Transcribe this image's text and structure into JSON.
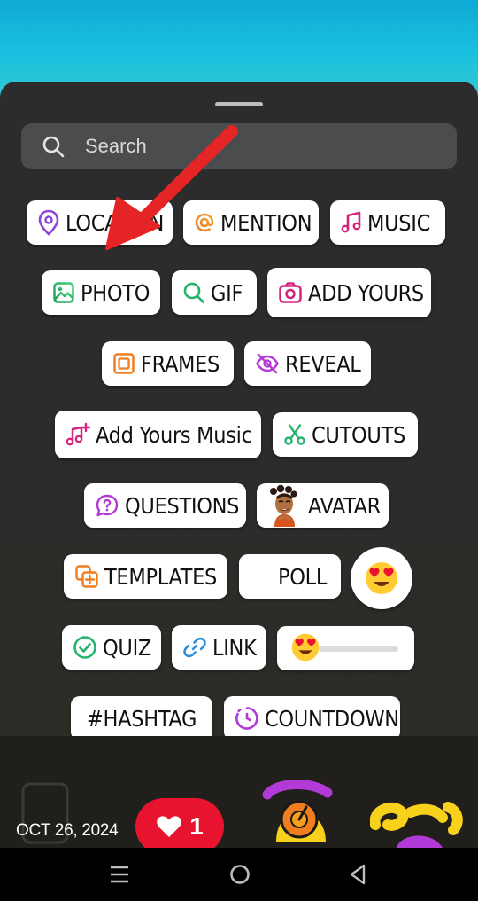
{
  "search": {
    "placeholder": "Search"
  },
  "stickers": {
    "location": "LOCATION",
    "mention": "MENTION",
    "music": "MUSIC",
    "photo": "PHOTO",
    "gif": "GIF",
    "add_yours": "ADD YOURS",
    "frames": "FRAMES",
    "reveal": "REVEAL",
    "add_yours_music": "Add Yours Music",
    "cutouts": "CUTOUTS",
    "questions": "QUESTIONS",
    "avatar": "AVATAR",
    "templates": "TEMPLATES",
    "poll": "POLL",
    "quiz": "QUIZ",
    "link": "LINK",
    "hashtag": "#HASHTAG",
    "countdown": "COUNTDOWN"
  },
  "footer": {
    "date": "OCT 26, 2024",
    "like_count": "1"
  },
  "colors": {
    "accent_purple": "#8e44d8",
    "accent_orange": "#f07d1e",
    "accent_magenta": "#d6247e",
    "accent_green": "#24b36b",
    "like_red": "#e8132e",
    "arrow_red": "#e52525"
  }
}
